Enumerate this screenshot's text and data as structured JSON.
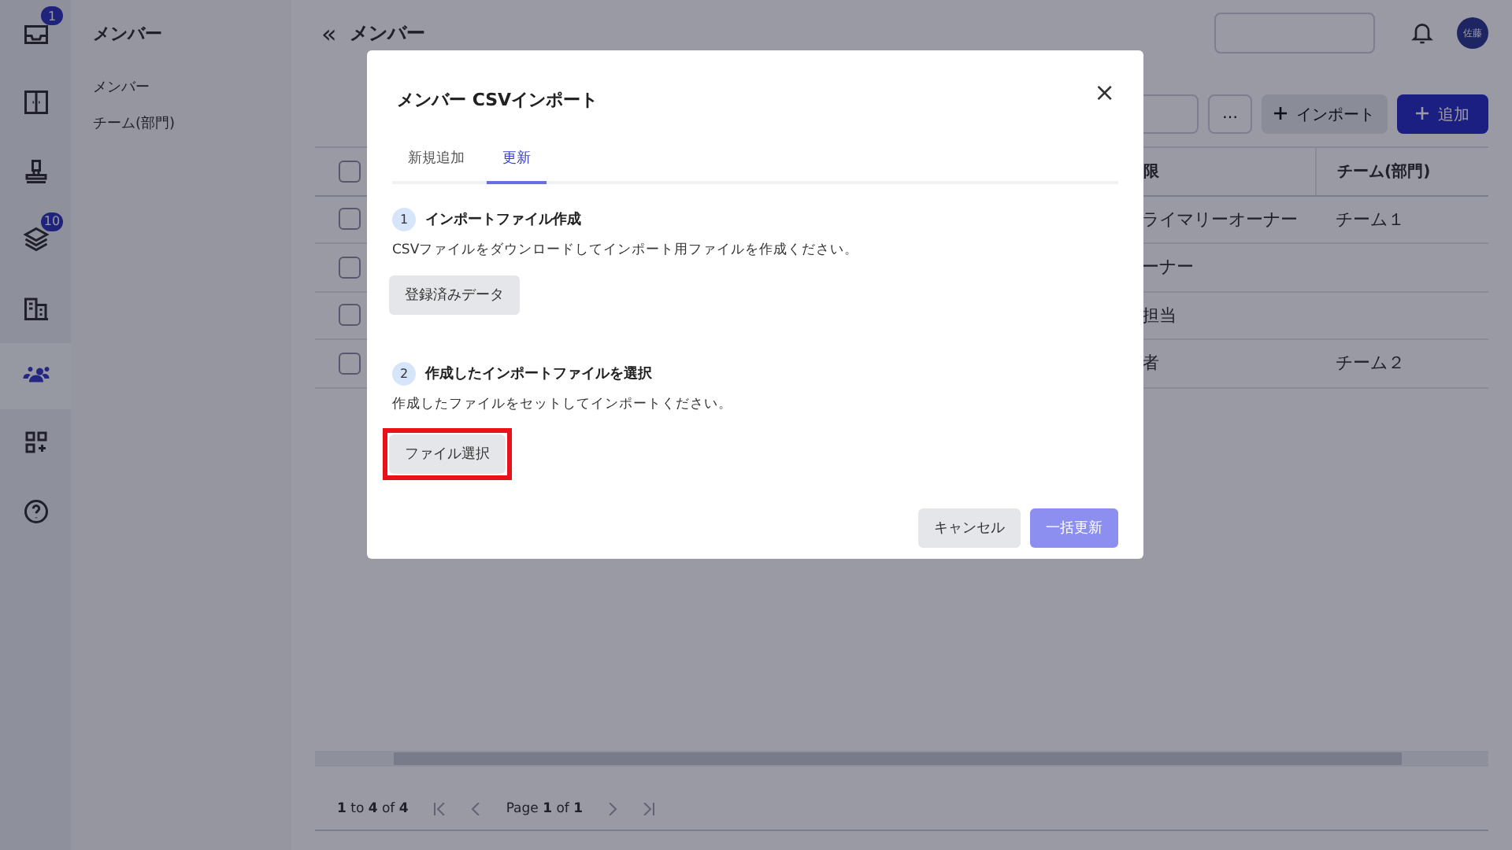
{
  "rail": {
    "items": [
      {
        "badge": "1",
        "selected": false
      },
      {
        "selected": false
      },
      {
        "selected": false
      },
      {
        "badge": "10",
        "selected": false
      },
      {
        "selected": false
      },
      {
        "selected": true
      },
      {
        "selected": false
      },
      {
        "selected": false
      }
    ]
  },
  "sidebar": {
    "title": "メンバー",
    "items": [
      {
        "label": "メンバー"
      },
      {
        "label": "チーム(部門)"
      }
    ]
  },
  "header": {
    "back": "«",
    "title": "メンバー",
    "avatar": "佐藤"
  },
  "toolbar": {
    "more": "…",
    "import": "インポート",
    "add": "追加"
  },
  "table": {
    "header_checked": false,
    "columns": [
      "限",
      "チーム(部門)"
    ],
    "rows": [
      {
        "checked": false,
        "cells": [
          "ライマリーオーナー",
          "チーム１"
        ]
      },
      {
        "checked": false,
        "cells": [
          "ーナー",
          ""
        ]
      },
      {
        "checked": false,
        "cells": [
          "担当",
          ""
        ]
      },
      {
        "checked": false,
        "cells": [
          "者",
          "チーム２"
        ]
      }
    ]
  },
  "pagination": {
    "range": "**1** to **4** of **4**",
    "page": "Page **1** of **1**"
  },
  "modal": {
    "title": "メンバー CSVインポート",
    "close": "×",
    "tabs": [
      {
        "label": "新規追加",
        "selected": false
      },
      {
        "label": "更新",
        "selected": true
      }
    ],
    "steps": [
      {
        "number": "1",
        "title": "インポートファイル作成",
        "text": "CSVファイルをダウンロードしてインポート用ファイルを作成ください。",
        "button": "登録済みデータ",
        "highlighted": false
      },
      {
        "number": "2",
        "title": "作成したインポートファイルを選択",
        "text": "作成したファイルをセットしてインポートください。",
        "button": "ファイル選択",
        "highlighted": true
      }
    ],
    "cancel": "キャンセル",
    "submit": "一括更新"
  }
}
